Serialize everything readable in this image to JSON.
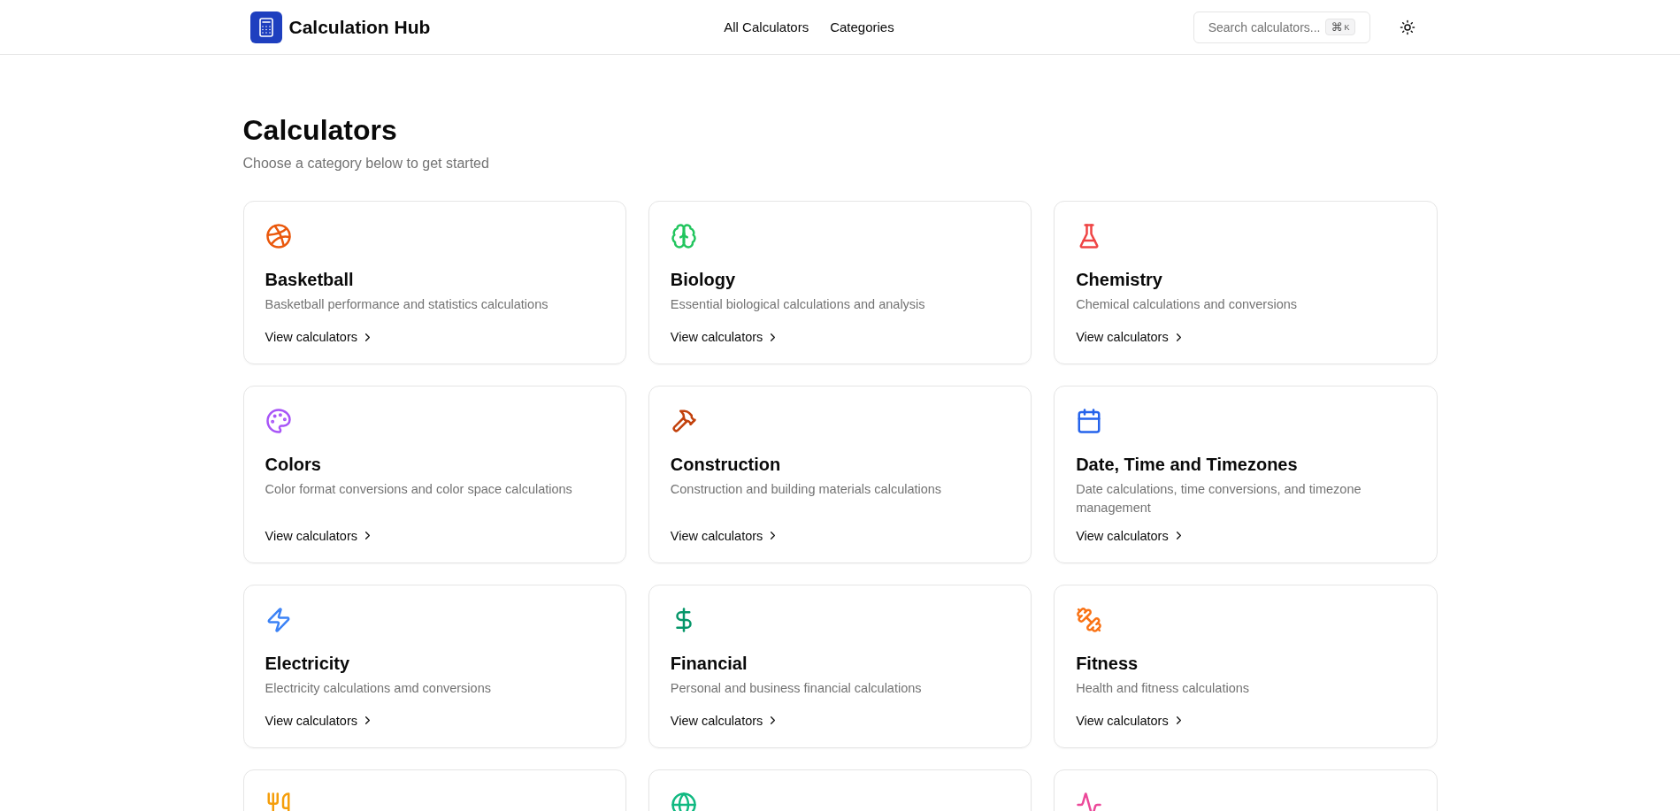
{
  "header": {
    "brand": "Calculation Hub",
    "nav": [
      "All Calculators",
      "Categories"
    ],
    "search": {
      "placeholder": "Search calculators...",
      "shortcut_symbol": "⌘",
      "shortcut_key": "K"
    }
  },
  "page": {
    "title": "Calculators",
    "subtitle": "Choose a category below to get started"
  },
  "categories": [
    {
      "color": "#ea580c",
      "title": "Basketball",
      "description": "Basketball performance and statistics calculations",
      "link": "View calculators"
    },
    {
      "color": "#22c55e",
      "title": "Biology",
      "description": "Essential biological calculations and analysis",
      "link": "View calculators"
    },
    {
      "color": "#ef4444",
      "title": "Chemistry",
      "description": "Chemical calculations and conversions",
      "link": "View calculators"
    },
    {
      "color": "#a855f7",
      "title": "Colors",
      "description": "Color format conversions and color space calculations",
      "link": "View calculators"
    },
    {
      "color": "#c2410c",
      "title": "Construction",
      "description": "Construction and building materials calculations",
      "link": "View calculators"
    },
    {
      "color": "#2563eb",
      "title": "Date, Time and Timezones",
      "description": "Date calculations, time conversions, and timezone management",
      "link": "View calculators"
    },
    {
      "color": "#3b82f6",
      "title": "Electricity",
      "description": "Electricity calculations amd conversions",
      "link": "View calculators"
    },
    {
      "color": "#059669",
      "title": "Financial",
      "description": "Personal and business financial calculations",
      "link": "View calculators"
    },
    {
      "color": "#f97316",
      "title": "Fitness",
      "description": "Health and fitness calculations",
      "link": "View calculators"
    },
    {
      "color": "#f59e0b"
    },
    {
      "color": "#10b981"
    },
    {
      "color": "#ec4899"
    }
  ]
}
